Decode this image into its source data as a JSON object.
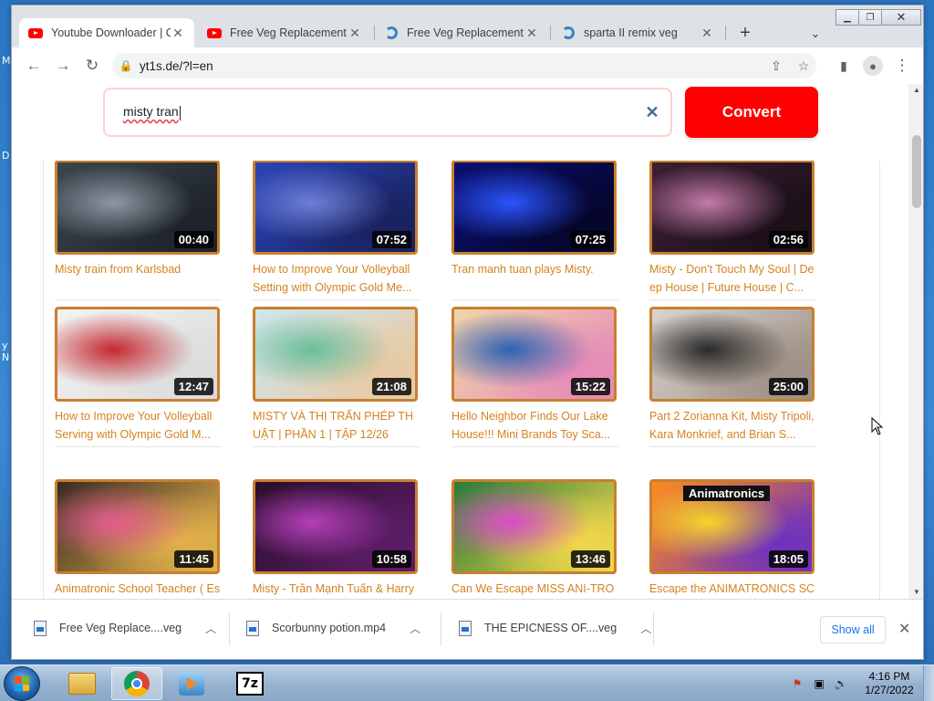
{
  "desktop": {
    "side_letters": [
      "M",
      "D",
      "y",
      "N"
    ]
  },
  "browser": {
    "tabs": [
      {
        "title": "Youtube Downloader | C",
        "icon": "youtube-icon",
        "active": true
      },
      {
        "title": "Free Veg Replacement (",
        "icon": "youtube-icon",
        "active": false
      },
      {
        "title": "Free Veg Replacement",
        "icon": "edge-icon",
        "active": false
      },
      {
        "title": "sparta II remix veg",
        "icon": "edge-icon",
        "active": false
      }
    ],
    "address": "yt1s.de/?l=en"
  },
  "page": {
    "search_value": "misty tran",
    "convert_label": "Convert",
    "results": [
      {
        "title": "Misty train from Karlsbad",
        "duration": "00:40",
        "colors": [
          "#3b434c",
          "#8d98a3",
          "#1d2329"
        ]
      },
      {
        "title": "How to Improve Your Volleyball Setting with Olympic Gold Me...",
        "duration": "07:52",
        "colors": [
          "#2a44b4",
          "#6d7fd6",
          "#19215e"
        ]
      },
      {
        "title": "Tran manh tuan plays Misty.",
        "duration": "07:25",
        "colors": [
          "#0b0f6e",
          "#2b55ff",
          "#05052a"
        ]
      },
      {
        "title": "Misty - Don't Touch My Soul | Deep House | Future House | C...",
        "duration": "02:56",
        "colors": [
          "#3b1f34",
          "#c37aa8",
          "#1a0f18"
        ]
      },
      {
        "title": "How to Improve Your Volleyball Serving with Olympic Gold M...",
        "duration": "12:47",
        "colors": [
          "#f3f3f3",
          "#c4282f",
          "#dcdcdc"
        ]
      },
      {
        "title": "MISTY VÀ THỊ TRẤN PHÉP THUẬT | PHẦN 1 | TẬP 12/26",
        "duration": "21:08",
        "colors": [
          "#cfe6ee",
          "#6bbf9c",
          "#e8c9a3"
        ]
      },
      {
        "title": "Hello Neighbor Finds Our Lake House!!! Mini Brands Toy Sca...",
        "duration": "15:22",
        "colors": [
          "#f1d4a8",
          "#2c63b3",
          "#e58ab7"
        ]
      },
      {
        "title": "Part 2 Zorianna Kit, Misty Tripoli, Kara Monkrief, and Brian S...",
        "duration": "25:00",
        "colors": [
          "#d9d4cf",
          "#2a2a2a",
          "#9d8f84"
        ]
      },
      {
        "title": "Animatronic School Teacher ( Escape Miss Ani-Tron's Detenti...",
        "duration": "11:45",
        "colors": [
          "#3a2a22",
          "#e25c8e",
          "#e4b24b"
        ]
      },
      {
        "title": "Misty - Trần Mạnh Tuấn & Harry Toledo. Jam at Saxnart Jazz...",
        "duration": "10:58",
        "colors": [
          "#2a0f2c",
          "#b43fb9",
          "#5d1d66"
        ]
      },
      {
        "title": "Can We Escape MISS ANI-TRON DETENTION In ROBLOX!? (...",
        "duration": "13:46",
        "colors": [
          "#2a7a3a",
          "#d94cc7",
          "#f3d84a"
        ]
      },
      {
        "title": "Escape the ANIMATRONICS SCHOOL in Roblox!",
        "duration": "18:05",
        "colors": [
          "#ff8a1c",
          "#f6d629",
          "#6c2fc1"
        ],
        "overlay_text": "Animatronics"
      }
    ]
  },
  "downloads": {
    "items": [
      "Free Veg Replace....veg",
      "Scorbunny potion.mp4",
      "THE EPICNESS OF....veg"
    ],
    "show_all": "Show all"
  },
  "taskbar": {
    "apps": [
      "explorer-icon",
      "chrome-icon",
      "media-player-icon",
      "7zip-icon"
    ],
    "sevenzip_label": "7z",
    "time": "4:16 PM",
    "date": "1/27/2022"
  },
  "colors": {
    "accent_red": "#ff0000",
    "card_title": "#d4831f",
    "thumb_border": "#c97f2e"
  }
}
